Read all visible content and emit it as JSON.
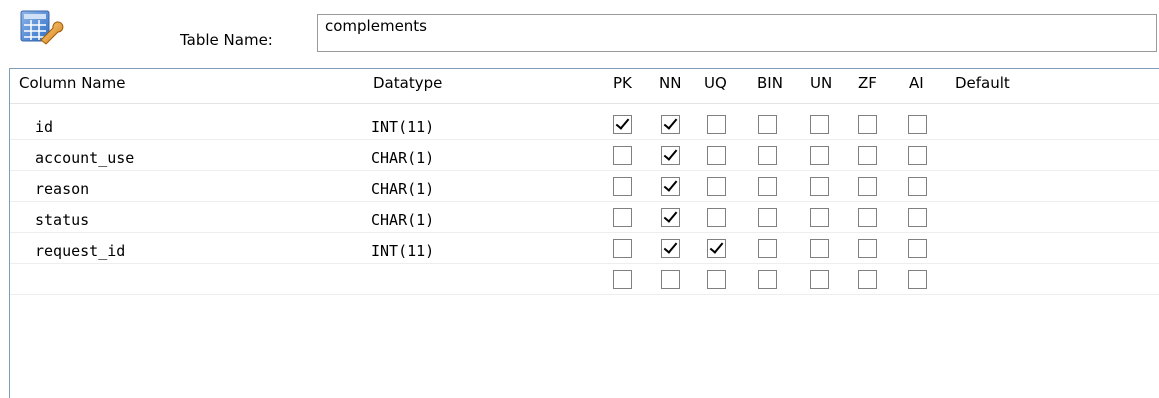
{
  "header": {
    "table_name_label": "Table Name:",
    "table_name_value": "complements"
  },
  "columns": {
    "column_name": "Column Name",
    "datatype": "Datatype",
    "pk": "PK",
    "nn": "NN",
    "uq": "UQ",
    "bin": "BIN",
    "un": "UN",
    "zf": "ZF",
    "ai": "AI",
    "default": "Default"
  },
  "rows": [
    {
      "name": "id",
      "datatype": "INT(11)",
      "flags": {
        "pk": true,
        "nn": true,
        "uq": false,
        "bin": false,
        "un": false,
        "zf": false,
        "ai": false
      }
    },
    {
      "name": "account_use",
      "datatype": "CHAR(1)",
      "flags": {
        "pk": false,
        "nn": true,
        "uq": false,
        "bin": false,
        "un": false,
        "zf": false,
        "ai": false
      }
    },
    {
      "name": "reason",
      "datatype": "CHAR(1)",
      "flags": {
        "pk": false,
        "nn": true,
        "uq": false,
        "bin": false,
        "un": false,
        "zf": false,
        "ai": false
      }
    },
    {
      "name": "status",
      "datatype": "CHAR(1)",
      "flags": {
        "pk": false,
        "nn": true,
        "uq": false,
        "bin": false,
        "un": false,
        "zf": false,
        "ai": false
      }
    },
    {
      "name": "request_id",
      "datatype": "INT(11)",
      "flags": {
        "pk": false,
        "nn": true,
        "uq": true,
        "bin": false,
        "un": false,
        "zf": false,
        "ai": false
      }
    },
    {
      "name": "",
      "datatype": "",
      "flags": {
        "pk": false,
        "nn": false,
        "uq": false,
        "bin": false,
        "un": false,
        "zf": false,
        "ai": false
      }
    }
  ],
  "icons": {
    "table_icon": "table-edit-icon"
  }
}
